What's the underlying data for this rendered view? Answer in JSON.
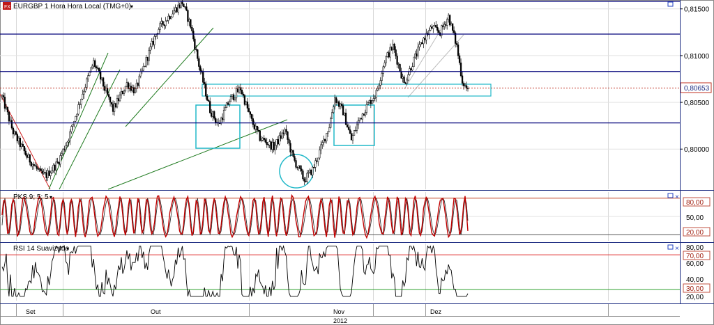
{
  "chart_data": [
    {
      "type": "candlestick",
      "title": "EURGBP 1 Hora Hora Local (TMG+0)",
      "yticks": [
        0.8,
        0.805,
        0.81,
        0.815
      ],
      "ytick_labels": [
        "0,80000",
        "0,80500",
        "0,81000",
        "0,81500"
      ],
      "ylim": [
        0.7957,
        0.8158
      ],
      "current_value": 0.80653,
      "current_value_label": "0,80653",
      "grid": true,
      "ohlc_path_anchors": [
        [
          0,
          0.8056
        ],
        [
          8,
          0.8018
        ],
        [
          18,
          0.7992
        ],
        [
          28,
          0.7973
        ],
        [
          32,
          0.7972
        ],
        [
          40,
          0.7985
        ],
        [
          48,
          0.8012
        ],
        [
          58,
          0.806
        ],
        [
          66,
          0.8093
        ],
        [
          72,
          0.8072
        ],
        [
          80,
          0.8042
        ],
        [
          90,
          0.807
        ],
        [
          96,
          0.8062
        ],
        [
          104,
          0.8095
        ],
        [
          112,
          0.8127
        ],
        [
          122,
          0.8145
        ],
        [
          130,
          0.8157
        ],
        [
          136,
          0.8132
        ],
        [
          142,
          0.809
        ],
        [
          150,
          0.8042
        ],
        [
          156,
          0.8026
        ],
        [
          164,
          0.8052
        ],
        [
          172,
          0.8065
        ],
        [
          180,
          0.803
        ],
        [
          186,
          0.8012
        ],
        [
          196,
          0.8002
        ],
        [
          204,
          0.802
        ],
        [
          210,
          0.799
        ],
        [
          218,
          0.7967
        ],
        [
          224,
          0.7978
        ],
        [
          228,
          0.7993
        ],
        [
          236,
          0.8025
        ],
        [
          240,
          0.8055
        ],
        [
          246,
          0.804
        ],
        [
          252,
          0.801
        ],
        [
          258,
          0.8033
        ],
        [
          264,
          0.8048
        ],
        [
          270,
          0.806
        ],
        [
          276,
          0.8095
        ],
        [
          282,
          0.811
        ],
        [
          290,
          0.807
        ],
        [
          296,
          0.8092
        ],
        [
          304,
          0.8118
        ],
        [
          310,
          0.813
        ],
        [
          316,
          0.8125
        ],
        [
          322,
          0.8142
        ],
        [
          328,
          0.811
        ],
        [
          332,
          0.8073
        ],
        [
          336,
          0.8062
        ]
      ],
      "horizontal_levels": [
        0.8083,
        0.8123,
        0.807,
        0.8028,
        0.81555
      ],
      "annotations": [
        "rectangles",
        "circle",
        "trendlines",
        "channel"
      ]
    },
    {
      "type": "line",
      "title": "PKS 9; 5; 5",
      "yticks": [
        20,
        50,
        80
      ],
      "ytick_labels": [
        "20,00",
        "50,00",
        "80,00"
      ],
      "levels": [
        80,
        20
      ],
      "ylim": [
        10,
        90
      ]
    },
    {
      "type": "line",
      "title": "RSI 14 Suavizado",
      "yticks": [
        20,
        30,
        40,
        60,
        70,
        80
      ],
      "ytick_labels": [
        "20,00",
        "30,00",
        "40,00",
        "60,00",
        "70,00",
        "80,00"
      ],
      "levels": [
        70,
        30
      ],
      "ylim": [
        17,
        83
      ]
    }
  ],
  "xaxis": {
    "month_labels": [
      "Set",
      "Out",
      "Nov",
      "Dez"
    ],
    "year_label": "2012"
  },
  "colors": {
    "blue_line": "#00007a",
    "red_series": "#c00000",
    "green_trend": "#1e7a1e",
    "cyan_box": "#20b8c8",
    "level_red": "#e03030",
    "level_green": "#30a030"
  }
}
